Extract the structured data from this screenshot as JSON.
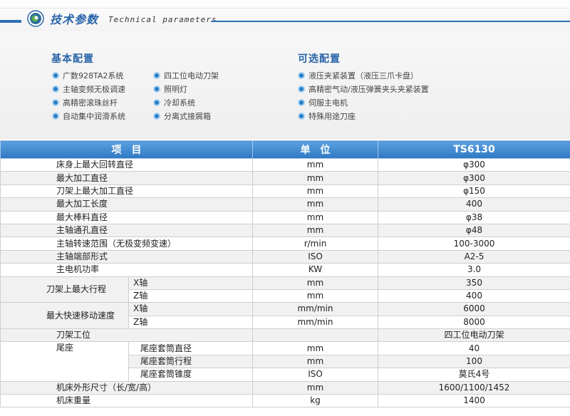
{
  "header": {
    "title_cn": "技术参数",
    "title_en": "Technical parameters"
  },
  "basic_config": {
    "title": "基本配置",
    "col1": [
      "广数928TA2系统",
      "主轴变频无极调速",
      "高精密滚珠丝杆",
      "自动集中润滑系统"
    ],
    "col2": [
      "四工位电动刀架",
      "照明灯",
      "冷却系统",
      "分离式接屑箱"
    ]
  },
  "optional_config": {
    "title": "可选配置",
    "items": [
      "液压夹紧装置（液压三爪卡盘）",
      "高精密气动/液压弹簧夹头夹紧装置",
      "伺服主电机",
      "特殊用途刀座"
    ]
  },
  "table": {
    "headers": [
      "项　目",
      "单　位",
      "TS6130"
    ],
    "rows": {
      "r1": {
        "item": "床身上最大回转直径",
        "unit": "mm",
        "value": "φ300"
      },
      "r2": {
        "item": "最大加工直径",
        "unit": "mm",
        "value": "φ300"
      },
      "r3": {
        "item": "刀架上最大加工直径",
        "unit": "mm",
        "value": "φ150"
      },
      "r4": {
        "item": "最大加工长度",
        "unit": "mm",
        "value": "400"
      },
      "r5": {
        "item": "最大棒料直径",
        "unit": "mm",
        "value": "φ38"
      },
      "r6": {
        "item": "主轴通孔直径",
        "unit": "mm",
        "value": "φ48"
      },
      "r7": {
        "item": "主轴转速范围（无极变频变速）",
        "unit": "r/min",
        "value": "100-3000"
      },
      "r8": {
        "item": "主轴端部形式",
        "unit": "ISO",
        "value": "A2-5"
      },
      "r9": {
        "item": "主电机功率",
        "unit": "KW",
        "value": "3.0"
      },
      "r10": {
        "group": "刀架上最大行程",
        "sub": "X轴",
        "unit": "mm",
        "value": "350"
      },
      "r11": {
        "sub": "Z轴",
        "unit": "mm",
        "value": "400"
      },
      "r12": {
        "group": "最大快速移动速度",
        "sub": "X轴",
        "unit": "mm/min",
        "value": "6000"
      },
      "r13": {
        "sub": "Z轴",
        "unit": "mm/min",
        "value": "8000"
      },
      "r14": {
        "item": "刀架工位",
        "unit": "",
        "value": "四工位电动刀架"
      },
      "r15": {
        "group": "尾座",
        "sub": "尾座套筒直径",
        "unit": "mm",
        "value": "40"
      },
      "r16": {
        "sub": "尾座套筒行程",
        "unit": "mm",
        "value": "100"
      },
      "r17": {
        "sub": "尾座套筒锥度",
        "unit": "ISO",
        "value": "莫氏4号"
      },
      "r18": {
        "item": "机床外形尺寸（长/宽/高）",
        "unit": "mm",
        "value": "1600/1100/1452"
      },
      "r19": {
        "item": "机床重量",
        "unit": "kg",
        "value": "1400"
      }
    }
  },
  "colors": {
    "accent": "#2a65a8",
    "header_bar": "#2f78c3",
    "bullet": "#2a7fc8"
  }
}
